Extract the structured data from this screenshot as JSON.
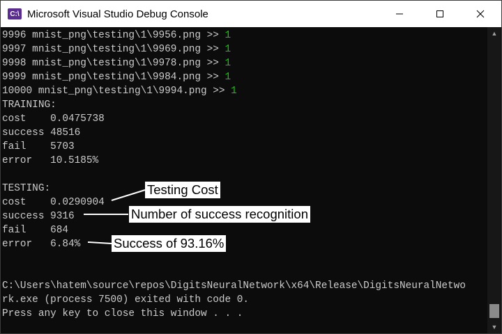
{
  "window": {
    "title": "Microsoft Visual Studio Debug Console",
    "app_icon_text": "C:\\",
    "minimize_glyph": "—",
    "maximize_glyph": "☐",
    "close_glyph": "✕"
  },
  "console": {
    "lines": [
      {
        "text": "9996 mnist_png\\testing\\1\\9956.png >> ",
        "result": "1"
      },
      {
        "text": "9997 mnist_png\\testing\\1\\9969.png >> ",
        "result": "1"
      },
      {
        "text": "9998 mnist_png\\testing\\1\\9978.png >> ",
        "result": "1"
      },
      {
        "text": "9999 mnist_png\\testing\\1\\9984.png >> ",
        "result": "1"
      },
      {
        "text": "10000 mnist_png\\testing\\1\\9994.png >> ",
        "result": "1"
      },
      {
        "text": "TRAINING:"
      },
      {
        "text": "cost    0.0475738"
      },
      {
        "text": "success 48516"
      },
      {
        "text": "fail    5703"
      },
      {
        "text": "error   10.5185%"
      },
      {
        "text": ""
      },
      {
        "text": "TESTING:"
      },
      {
        "text": "cost    0.0290904"
      },
      {
        "text": "success 9316"
      },
      {
        "text": "fail    684"
      },
      {
        "text": "error   6.84%"
      },
      {
        "text": ""
      },
      {
        "text": ""
      },
      {
        "text": "C:\\Users\\hatem\\source\\repos\\DigitsNeuralNetwork\\x64\\Release\\DigitsNeuralNetwo"
      },
      {
        "text": "rk.exe (process 7500) exited with code 0."
      },
      {
        "text": "Press any key to close this window . . ."
      }
    ]
  },
  "annotations": {
    "testing_cost": "Testing Cost",
    "success_count": "Number of success recognition",
    "success_rate": "Success of 93.16%"
  },
  "colors": {
    "console_bg": "#0c0c0c",
    "console_text": "#cccccc",
    "result_green": "#16c60c"
  }
}
